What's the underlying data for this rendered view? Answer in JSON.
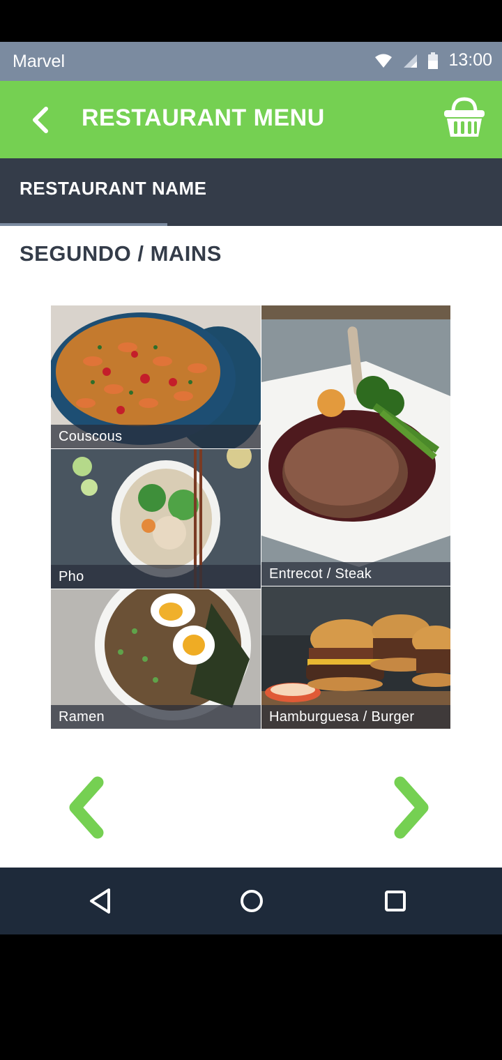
{
  "status_bar": {
    "carrier": "Marvel",
    "time": "13:00",
    "icons": [
      "wifi-icon",
      "signal-icon",
      "battery-icon"
    ]
  },
  "app_bar": {
    "title": "RESTAURANT MENU",
    "back_icon": "chevron-left-icon",
    "cart_icon": "basket-icon"
  },
  "tabs": [
    {
      "label": "RESTAURANT NAME",
      "selected": true
    }
  ],
  "section": {
    "title": "SEGUNDO / MAINS"
  },
  "dishes": [
    {
      "name": "Couscous"
    },
    {
      "name": "Entrecot / Steak"
    },
    {
      "name": "Pho"
    },
    {
      "name": "Ramen"
    },
    {
      "name": "Hamburguesa / Burger"
    }
  ],
  "pager": {
    "prev_icon": "chevron-left-icon",
    "next_icon": "chevron-right-icon"
  },
  "nav_bar": {
    "icons": [
      "back-triangle-icon",
      "home-circle-icon",
      "recents-square-icon"
    ]
  },
  "colors": {
    "accent": "#75d052",
    "header_dark": "#343c49",
    "status": "#7b8ba0",
    "nav": "#1e2a3a"
  }
}
